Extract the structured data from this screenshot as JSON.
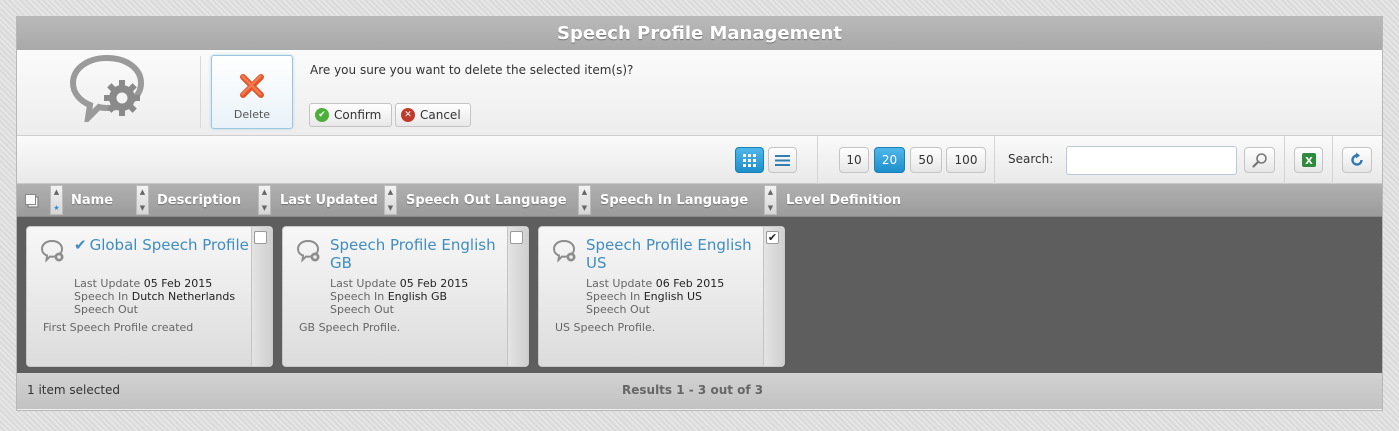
{
  "window": {
    "title": "Speech Profile Management"
  },
  "header": {
    "delete_label": "Delete",
    "confirm_message": "Are you sure you want to delete the selected item(s)?",
    "confirm_label": "Confirm",
    "cancel_label": "Cancel"
  },
  "toolbar": {
    "page_sizes": [
      "10",
      "20",
      "50",
      "100"
    ],
    "active_page_size": "20",
    "search_label": "Search:",
    "search_value": ""
  },
  "columns": [
    "Name",
    "Description",
    "Last Updated",
    "Speech Out Language",
    "Speech In Language",
    "Level Definition"
  ],
  "cards": [
    {
      "title": "Global Speech Profile",
      "is_default": true,
      "checked": false,
      "last_update_label": "Last Update",
      "last_update": "05 Feb 2015",
      "speech_in_label": "Speech In",
      "speech_in": "Dutch Netherlands",
      "speech_out_label": "Speech Out",
      "speech_out": "",
      "description": "First Speech Profile created"
    },
    {
      "title": "Speech Profile English GB",
      "is_default": false,
      "checked": false,
      "last_update_label": "Last Update",
      "last_update": "05 Feb 2015",
      "speech_in_label": "Speech In",
      "speech_in": "English GB",
      "speech_out_label": "Speech Out",
      "speech_out": "",
      "description": "GB Speech Profile."
    },
    {
      "title": "Speech Profile English US",
      "is_default": false,
      "checked": true,
      "last_update_label": "Last Update",
      "last_update": "06 Feb 2015",
      "speech_in_label": "Speech In",
      "speech_in": "English US",
      "speech_out_label": "Speech Out",
      "speech_out": "",
      "description": "US Speech Profile."
    }
  ],
  "footer": {
    "selection_text": "1 item selected",
    "results_text": "Results 1 - 3 out of 3"
  },
  "colors": {
    "accent": "#1d8fcb",
    "title_link": "#3f8dbf",
    "delete_red": "#e0542a",
    "confirm_green": "#4caf3a",
    "cancel_red": "#c0392b",
    "excel_green": "#2e8b3e"
  }
}
